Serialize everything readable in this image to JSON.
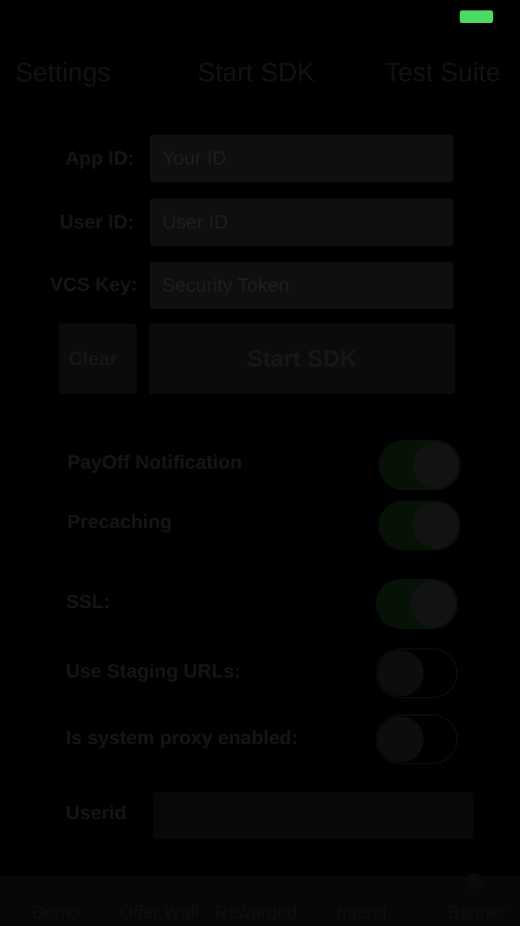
{
  "topnav": {
    "settings_label": "Settings",
    "start_label": "Start SDK",
    "test_label": "Test Suite"
  },
  "form": {
    "app_id_label": "App ID:",
    "app_id_placeholder": "Your ID",
    "user_id_label": "User ID:",
    "user_id_placeholder": "User ID",
    "vcs_key_label": "VCS Key:",
    "vcs_key_placeholder": "Security Token",
    "clear_label": "Clear",
    "start_label": "Start SDK"
  },
  "toggles": {
    "payoff_label": "PayOff Notification",
    "payoff_on": true,
    "precaching_label": "Precaching",
    "precaching_on": true,
    "ssl_label": "SSL:",
    "ssl_on": true,
    "staging_label": "Use Staging URLs:",
    "staging_on": false,
    "proxy_label": "Is system proxy enabled:",
    "proxy_on": false
  },
  "userid": {
    "label": "Userid",
    "value": ""
  },
  "tabbar": {
    "tabs": [
      "Demo",
      "Offer Wall",
      "Rewarded",
      "Interst.",
      "Banner"
    ]
  },
  "colors": {
    "battery": "#4cd964",
    "background": "#000000"
  }
}
